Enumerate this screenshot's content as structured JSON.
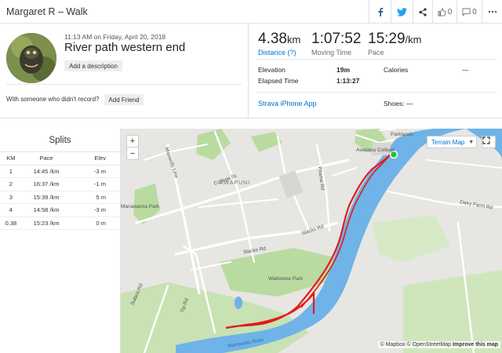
{
  "header": {
    "title": "Margaret R – Walk",
    "kudos_count": "0",
    "comments_count": "0"
  },
  "activity": {
    "datetime": "11:13 AM on Friday, April 20, 2018",
    "name": "River path western end",
    "add_description": "Add a description",
    "friend_question": "With someone who didn't record?",
    "add_friend": "Add Friend"
  },
  "stats": {
    "distance": {
      "value": "4.38",
      "unit": "km",
      "label": "Distance (?)"
    },
    "moving_time": {
      "value": "1:07:52",
      "label": "Moving Time"
    },
    "pace": {
      "value": "15:29",
      "unit": "/km",
      "label": "Pace"
    }
  },
  "details": {
    "elevation_label": "Elevation",
    "elevation_value": "19m",
    "calories_label": "Calories",
    "calories_value": "—",
    "elapsed_label": "Elapsed Time",
    "elapsed_value": "1:13:27",
    "device": "Strava iPhone App",
    "shoes": "Shoes: —"
  },
  "splits": {
    "title": "Splits",
    "columns": [
      "KM",
      "Pace",
      "Elev"
    ],
    "rows": [
      [
        "1",
        "14:45 /km",
        "-3 m"
      ],
      [
        "2",
        "16:37 /km",
        "-1 m"
      ],
      [
        "3",
        "15:39 /km",
        "5 m"
      ],
      [
        "4",
        "14:58 /km",
        "-3 m"
      ],
      [
        "0.38",
        "15:23 /km",
        "0 m"
      ]
    ]
  },
  "map": {
    "zoom_in": "+",
    "zoom_out": "−",
    "terrain_label": "Terrain Map",
    "attribution_mapbox": "© Mapbox",
    "attribution_osm": "© OpenStreetMap",
    "improve": "Improve this map",
    "labels": {
      "awapuni": "AWAPUNI",
      "college_st": "College St",
      "maxwells_line": "Maxwells Line",
      "manawaroa_park": "Manawaroa Park",
      "pitama_rd": "Pitama Rd",
      "slacks_rd": "Slacks Rd",
      "slacks_rd2": "Slacks Rd",
      "waitoetoe_park": "Waitoetoe Park",
      "awatapu_college": "Awatapu College",
      "dairy_farm_rd": "Dairy Farm Rd",
      "tip_rd": "Tip Rd",
      "sutara_rd": "Sutara Rd",
      "manawatu_river": "Manawatu River",
      "parklands": "Parklands"
    },
    "colors": {
      "route": "#e31b1b",
      "river": "#6fb3e8",
      "park": "#b9dba0",
      "start": "#24c23a"
    }
  }
}
